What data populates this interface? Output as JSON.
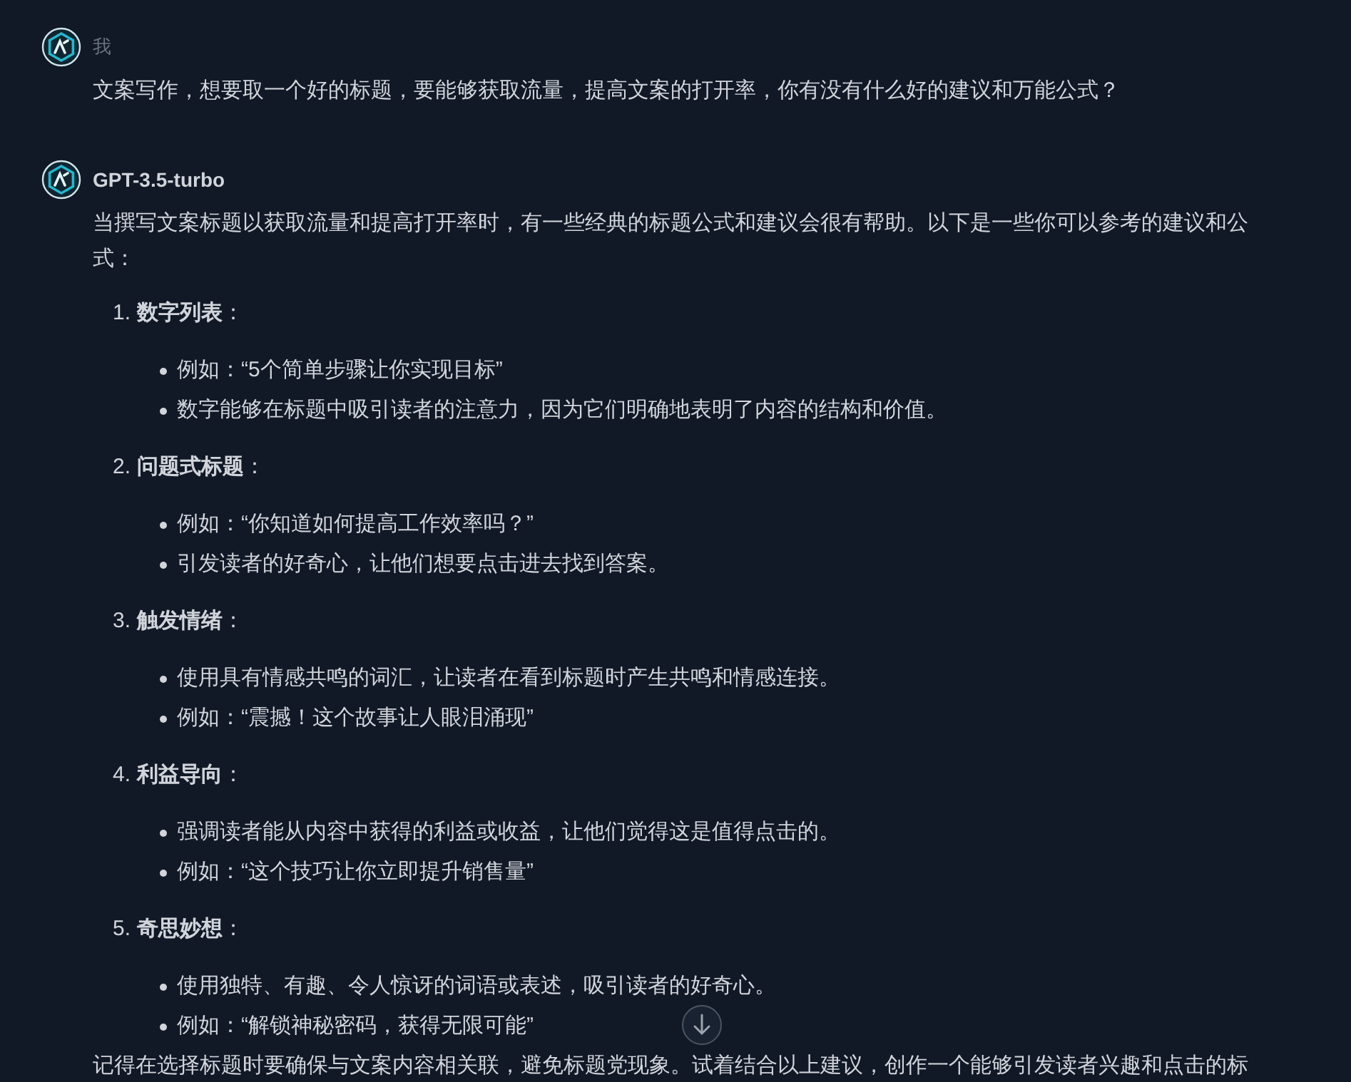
{
  "messages": [
    {
      "kind": "user",
      "author": "我",
      "text": "文案写作，想要取一个好的标题，要能够获取流量，提高文案的打开率，你有没有什么好的建议和万能公式？"
    },
    {
      "kind": "assistant",
      "author": "GPT-3.5-turbo",
      "intro": "当撰写文案标题以获取流量和提高打开率时，有一些经典的标题公式和建议会很有帮助。以下是一些你可以参考的建议和公式：",
      "sections": [
        {
          "number": "1.",
          "title": "**数字列表**：",
          "bullets": [
            "例如：“5个简单步骤让你实现目标”",
            "数字能够在标题中吸引读者的注意力，因为它们明确地表明了内容的结构和价值。"
          ]
        },
        {
          "number": "2.",
          "title": "**问题式标题**：",
          "bullets": [
            "例如：“你知道如何提高工作效率吗？”",
            "引发读者的好奇心，让他们想要点击进去找到答案。"
          ]
        },
        {
          "number": "3.",
          "title": "**触发情绪**：",
          "bullets": [
            "使用具有情感共鸣的词汇，让读者在看到标题时产生共鸣和情感连接。",
            "例如：“震撼！这个故事让人眼泪涌现”"
          ]
        },
        {
          "number": "4.",
          "title": "**利益导向**：",
          "bullets": [
            "强调读者能从内容中获得的利益或收益，让他们觉得这是值得点击的。",
            "例如：“这个技巧让你立即提升销售量”"
          ]
        },
        {
          "number": "5.",
          "title": "**奇思妙想**：",
          "bullets": [
            "使用独特、有趣、令人惊讶的词语或表述，吸引读者的好奇心。",
            "例如：“解锁神秘密码，获得无限可能”"
          ]
        }
      ],
      "outro": "记得在选择标题时要确保与文案内容相关联，避免标题党现象。试着结合以上建议，创作一个能够引发读者兴趣和点击的标"
    }
  ]
}
